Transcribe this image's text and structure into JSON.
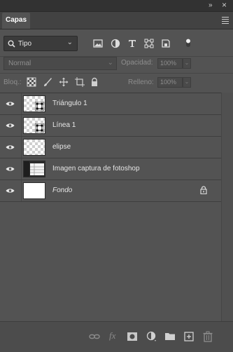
{
  "window": {
    "collapse_glyph": "»",
    "close_glyph": "×"
  },
  "tab": {
    "label": "Capas"
  },
  "filter": {
    "kind_value": "Tipo",
    "icons": [
      "image-filter-icon",
      "adjustment-filter-icon",
      "type-filter-icon",
      "shape-filter-icon",
      "smart-object-filter-icon",
      "filter-toggle-icon"
    ]
  },
  "blend": {
    "mode_value": "Normal",
    "opacity_label": "Opacidad:",
    "opacity_value": "100%"
  },
  "lock": {
    "label": "Bloq.:",
    "fill_label": "Relleno:",
    "fill_value": "100%"
  },
  "layers": [
    {
      "name": "Triángulo 1",
      "thumb": "shape",
      "visible": true,
      "italic": false,
      "locked": false
    },
    {
      "name": "Línea 1",
      "thumb": "shape",
      "visible": true,
      "italic": false,
      "locked": false
    },
    {
      "name": "elipse",
      "thumb": "transparent",
      "visible": true,
      "italic": false,
      "locked": false
    },
    {
      "name": "Imagen captura de fotoshop",
      "thumb": "screenshot",
      "visible": true,
      "italic": false,
      "locked": false
    },
    {
      "name": "Fondo",
      "thumb": "white",
      "visible": true,
      "italic": true,
      "locked": true
    }
  ],
  "bottom_icons": [
    "link-layers-icon",
    "fx-icon",
    "mask-icon",
    "adjustment-layer-icon",
    "folder-icon",
    "new-layer-icon",
    "trash-icon"
  ],
  "colors": {
    "panel": "#535353",
    "dark": "#323232",
    "text": "#e6e6e6"
  }
}
